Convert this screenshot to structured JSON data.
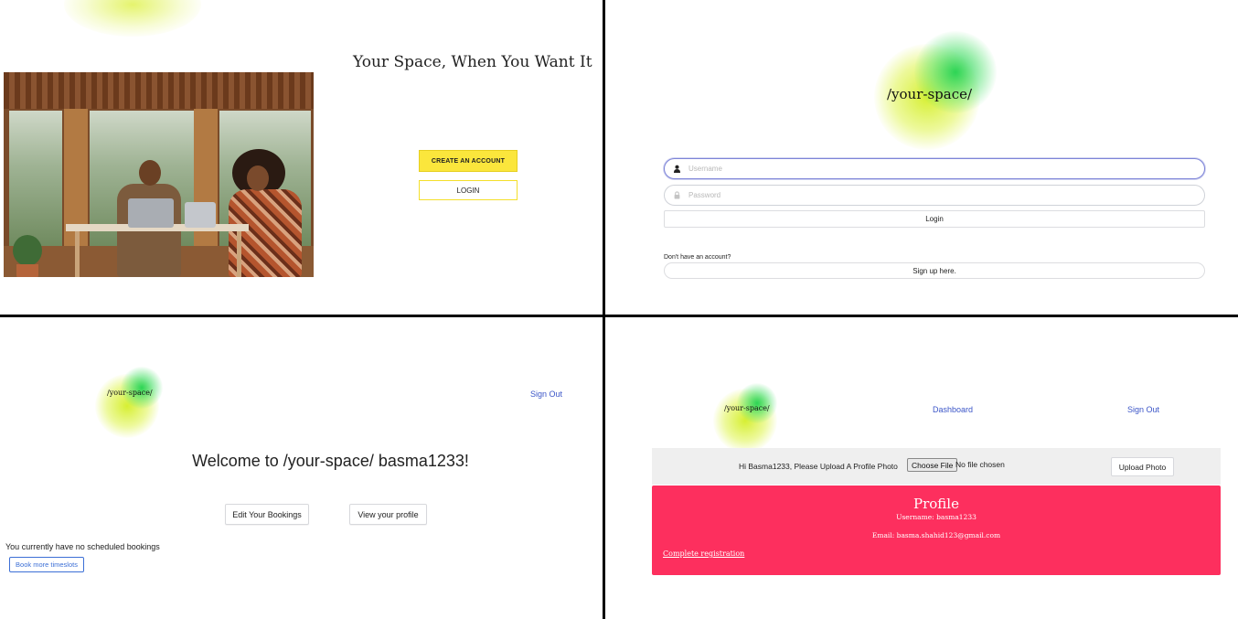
{
  "landing": {
    "tagline": "Your Space, When You Want It",
    "create_account_label": "CREATE AN ACCOUNT",
    "login_label": "LOGIN",
    "colors": {
      "accent_yellow": "#fbe63c"
    }
  },
  "login_page": {
    "logo_text": "/your-space/",
    "username_placeholder": "Username",
    "password_placeholder": "Password",
    "login_button": "Login",
    "no_account_text": "Don't have an account?",
    "signup_button": "Sign up here.",
    "colors": {
      "focus_border": "#7d84d8"
    }
  },
  "dashboard": {
    "logo_text": "/your-space/",
    "sign_out": "Sign Out",
    "welcome": "Welcome to /your-space/ basma1233!",
    "edit_bookings": "Edit Your Bookings",
    "view_profile": "View your profile",
    "no_bookings_text": "You currently have no scheduled bookings",
    "book_more": "Book more timeslots",
    "colors": {
      "link": "#3c56c8"
    }
  },
  "profile_page": {
    "logo_text": "/your-space/",
    "dashboard_link": "Dashboard",
    "sign_out": "Sign Out",
    "upload_prompt": "Hi Basma1233, Please Upload A Profile Photo",
    "choose_file": "Choose File",
    "no_file": "No file chosen",
    "upload_button": "Upload Photo",
    "card_title": "Profile",
    "username_line": "Username: basma1233",
    "email_line": "Email: basma.shahid123@gmail.com",
    "complete_registration": "Complete registration",
    "colors": {
      "card_bg": "#fd2f5e"
    }
  }
}
